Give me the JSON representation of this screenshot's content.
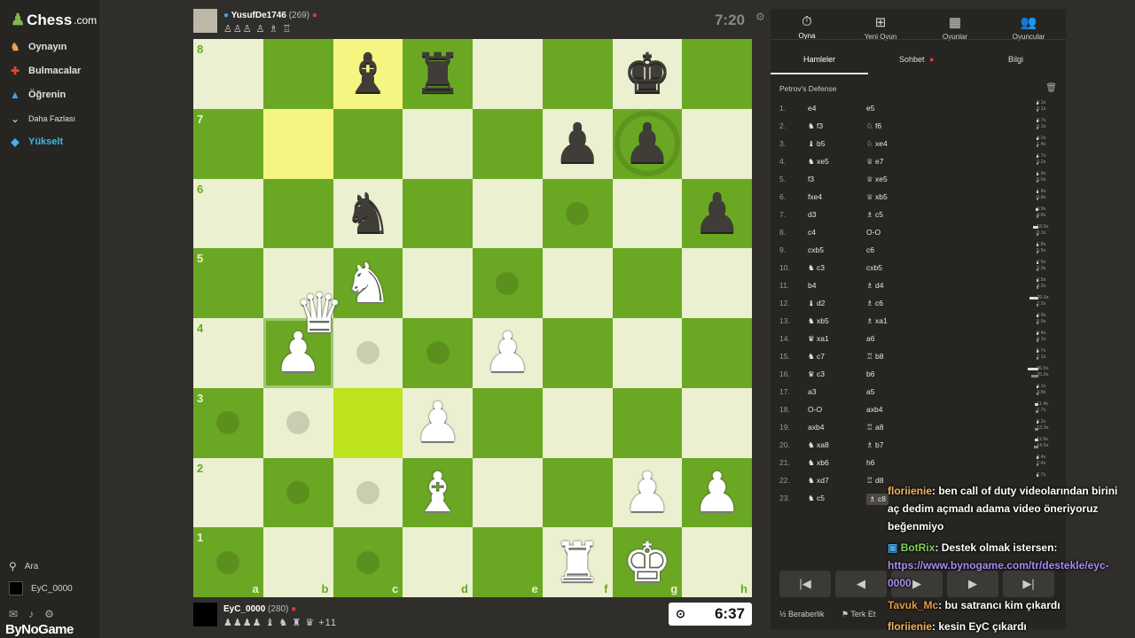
{
  "sidebar": {
    "logo": "Chess",
    "logo_suffix": ".com",
    "items": [
      {
        "label": "Oynayın",
        "icon": "play-icon"
      },
      {
        "label": "Bulmacalar",
        "icon": "puzzle-icon"
      },
      {
        "label": "Öğrenin",
        "icon": "learn-icon"
      },
      {
        "label": "Daha Fazlası",
        "icon": "chevron-down-icon"
      },
      {
        "label": "Yükselt",
        "icon": "diamond-icon"
      }
    ],
    "search_label": "Ara",
    "user_label": "EyC_0000",
    "brand_overlay": "ByNoGame"
  },
  "top_player": {
    "name": "YusufDe1746",
    "rating": "(269)",
    "captured": "♙♙♙ ♙ ♗ ♖",
    "clock": "7:20"
  },
  "bottom_player": {
    "name": "EyC_0000",
    "rating": "(280)",
    "captured": "♟♟♟♟ ♝ ♞ ♜ ♛",
    "advantage": "+11",
    "clock": "6:37"
  },
  "board": {
    "ranks": [
      "8",
      "7",
      "6",
      "5",
      "4",
      "3",
      "2",
      "1"
    ],
    "files": [
      "a",
      "b",
      "c",
      "d",
      "e",
      "f",
      "g",
      "h"
    ],
    "pieces": [
      {
        "sq": "c8",
        "glyph": "♝",
        "color": "black"
      },
      {
        "sq": "d8",
        "glyph": "♜",
        "color": "black"
      },
      {
        "sq": "g8",
        "glyph": "♚",
        "color": "black"
      },
      {
        "sq": "f7",
        "glyph": "♟",
        "color": "black"
      },
      {
        "sq": "g7",
        "glyph": "♟",
        "color": "black"
      },
      {
        "sq": "c6",
        "glyph": "♞",
        "color": "black"
      },
      {
        "sq": "h6",
        "glyph": "♟",
        "color": "black"
      },
      {
        "sq": "c5",
        "glyph": "♞",
        "color": "white"
      },
      {
        "sq": "b4",
        "glyph": "♟",
        "color": "white"
      },
      {
        "sq": "e4",
        "glyph": "♟",
        "color": "white"
      },
      {
        "sq": "d3",
        "glyph": "♟",
        "color": "white"
      },
      {
        "sq": "d2",
        "glyph": "♝",
        "color": "white"
      },
      {
        "sq": "g2",
        "glyph": "♟",
        "color": "white"
      },
      {
        "sq": "h2",
        "glyph": "♟",
        "color": "white"
      },
      {
        "sq": "f1",
        "glyph": "♜",
        "color": "white"
      },
      {
        "sq": "g1",
        "glyph": "♚",
        "color": "white"
      }
    ],
    "dragged_piece": {
      "glyph": "♛",
      "color": "white",
      "near": "b4"
    },
    "highlight_yellow": [
      "c8",
      "b7"
    ],
    "highlight_lime": [
      "c3"
    ],
    "selected": [
      "b4"
    ],
    "move_dots": [
      "f6",
      "e5",
      "c4",
      "d4",
      "a3",
      "b3",
      "b2",
      "c2",
      "a1",
      "c1"
    ],
    "capture_ring": [
      "g7"
    ]
  },
  "panel": {
    "top_tabs": [
      {
        "label": "Oyna",
        "icon": "stopwatch-icon"
      },
      {
        "label": "Yeni Oyun",
        "icon": "plus-icon"
      },
      {
        "label": "Oyunlar",
        "icon": "board-icon"
      },
      {
        "label": "Oyuncular",
        "icon": "players-icon"
      }
    ],
    "sub_tabs": [
      "Hamleler",
      "Sohbet",
      "Bilgi"
    ],
    "opening": "Petrov's Defense",
    "moves": [
      {
        "n": "1.",
        "w": "e4",
        "b": "e5",
        "tw": "0.1s",
        "tb": "0.1s"
      },
      {
        "n": "2.",
        "w": "♞ f3",
        "b": "♘ f6",
        "tw": "3.7s",
        "tb": "0.1s"
      },
      {
        "n": "3.",
        "w": "♝ b5",
        "b": "♘ xe4",
        "tw": "4.2s",
        "tb": "1.4s"
      },
      {
        "n": "4.",
        "w": "♞ xe5",
        "b": "♕ e7",
        "tw": "1.7s",
        "tb": "3.2s"
      },
      {
        "n": "5.",
        "w": "f3",
        "b": "♕ xe5",
        "tw": "1.9s",
        "tb": "5.0s"
      },
      {
        "n": "6.",
        "w": "fxe4",
        "b": "♕ xb5",
        "tw": "1.8s",
        "tb": "0.8s"
      },
      {
        "n": "7.",
        "w": "d3",
        "b": "♗ c5",
        "tw": "9.9s",
        "tb": "4.8s"
      },
      {
        "n": "8.",
        "w": "c4",
        "b": "O-O",
        "tw": "18.9s",
        "tb": "0.1s"
      },
      {
        "n": "9.",
        "w": "cxb5",
        "b": "c6",
        "tw": "1.8s",
        "tb": "5.5s"
      },
      {
        "n": "10.",
        "w": "♞ c3",
        "b": "cxb5",
        "tw": "2.5s",
        "tb": "2.3s"
      },
      {
        "n": "11.",
        "w": "b4",
        "b": "♗ d4",
        "tw": "2.5s",
        "tb": "4.2s"
      },
      {
        "n": "12.",
        "w": "♝ d2",
        "b": "♗ c6",
        "tw": "29.9s",
        "tb": "7.2s"
      },
      {
        "n": "13.",
        "w": "♞ xb5",
        "b": "♗ xa1",
        "tw": "4.9s",
        "tb": "5.0s"
      },
      {
        "n": "14.",
        "w": "♛ xa1",
        "b": "a6",
        "tw": "0.4s",
        "tb": "4.1s"
      },
      {
        "n": "15.",
        "w": "♞ c7",
        "b": "♖ b8",
        "tw": "5.7s",
        "tb": "7.1s"
      },
      {
        "n": "16.",
        "w": "♛ c3",
        "b": "b6",
        "tw": "36.5s",
        "tb": "25.0s"
      },
      {
        "n": "17.",
        "w": "a3",
        "b": "a5",
        "tw": "4.1s",
        "tb": "3.8s"
      },
      {
        "n": "18.",
        "w": "O-O",
        "b": "axb4",
        "tw": "11.4s",
        "tb": "7.7s"
      },
      {
        "n": "19.",
        "w": "axb4",
        "b": "♖ a8",
        "tw": "3.2s",
        "tb": "13.3s"
      },
      {
        "n": "20.",
        "w": "♞ xa8",
        "b": "♗ b7",
        "tw": "11.9s",
        "tb": "14.5s"
      },
      {
        "n": "21.",
        "w": "♞ xb6",
        "b": "h6",
        "tw": "3.4s",
        "tb": "7.4s"
      },
      {
        "n": "22.",
        "w": "♞ xd7",
        "b": "♖ d8",
        "tw": "2.7s",
        "tb": ""
      },
      {
        "n": "23.",
        "w": "♞ c5",
        "b": "♗ c8",
        "tw": "",
        "tb": ""
      }
    ],
    "controls": [
      "first-icon",
      "prev-icon",
      "next-icon",
      "next-icon",
      "last-icon"
    ],
    "footer": [
      "Beraberlik",
      "Terk Et"
    ]
  },
  "chat": [
    {
      "user": "floriienie",
      "text": ": ben call of duty videolarından birini aç dedim açmadı adama video öneriyoruz beğenmiyo"
    },
    {
      "user": "BotRix",
      "text": ": Destek olmak istersen: ",
      "link": "https://www.bynogame.com/tr/destekle/eyc-0000"
    },
    {
      "user": "Tavuk_Mc",
      "text": ": bu satrancı kim çıkardı"
    },
    {
      "user": "floriienie",
      "text": ": kesin EyC çıkardı"
    }
  ],
  "colors": {
    "light": "#ebf0d0",
    "dark": "#6aa823",
    "accent": "#81b64c"
  }
}
